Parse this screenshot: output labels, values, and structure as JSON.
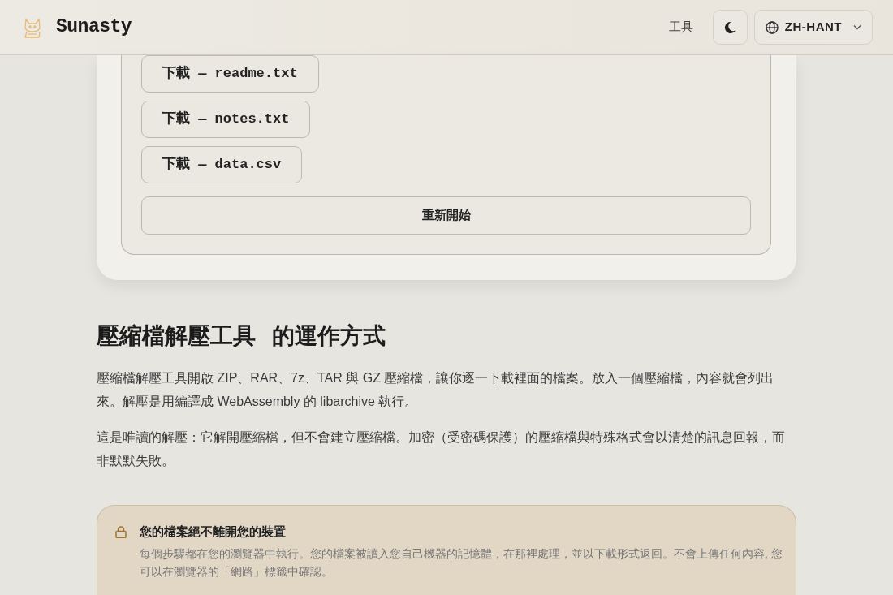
{
  "header": {
    "brand": "Sunasty",
    "nav_link": "工具",
    "language": "ZH-HANT"
  },
  "result": {
    "downloads": [
      "下載 — readme.txt",
      "下載 — notes.txt",
      "下載 — data.csv"
    ],
    "restart_button": "重新開始"
  },
  "how_it_works": {
    "title": "壓縮檔解壓工具 的運作方式",
    "paragraphs": [
      "壓縮檔解壓工具開啟 ZIP、RAR、7z、TAR 與 GZ 壓縮檔，讓你逐一下載裡面的檔案。放入一個壓縮檔，內容就會列出來。解壓是用編譯成 WebAssembly 的 libarchive 執行。",
      "這是唯讀的解壓：它解開壓縮檔，但不會建立壓縮檔。加密（受密碼保護）的壓縮檔與特殊格式會以清楚的訊息回報，而非默默失敗。"
    ]
  },
  "privacy_notice": {
    "title": "您的檔案絕不離開您的裝置",
    "text": "每個步驟都在您的瀏覽器中執行。您的檔案被讀入您自己機器的記憶體，在那裡處理，並以下載形式返回。不會上傳任何內容, 您可以在瀏覽器的「網路」標籤中確認。"
  }
}
